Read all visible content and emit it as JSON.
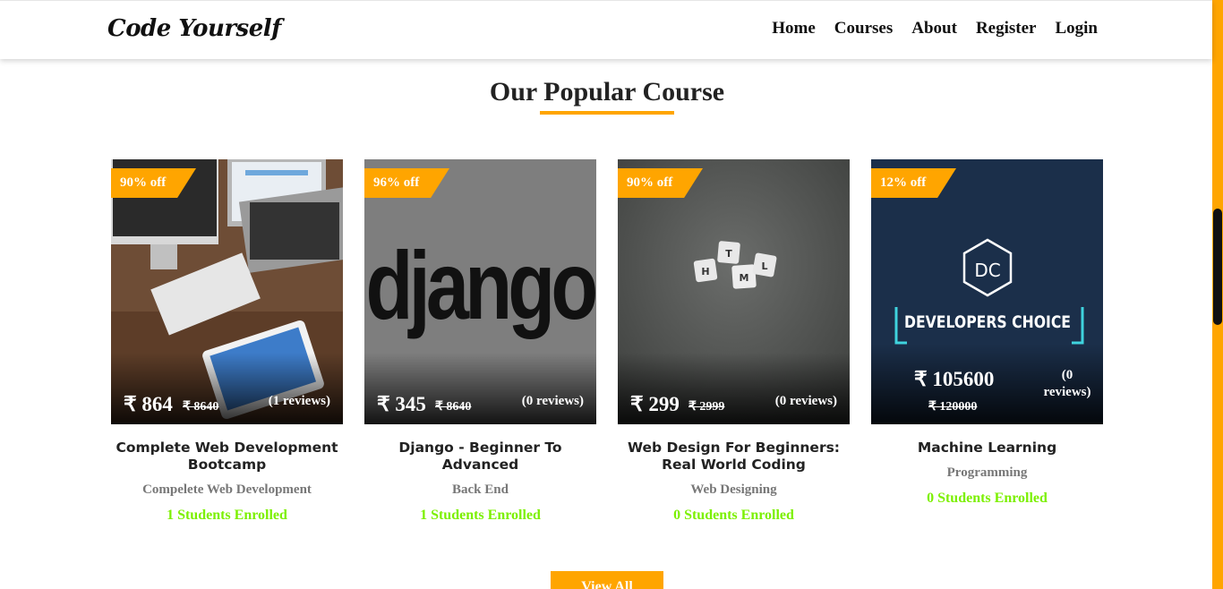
{
  "brand": "Code Yourself",
  "nav": [
    "Home",
    "Courses",
    "About",
    "Register",
    "Login"
  ],
  "section_title": "Our Popular Course",
  "cards": [
    {
      "badge": "90% off",
      "price": "₹ 864",
      "old_price": "₹ 8640",
      "reviews": "(1 reviews)",
      "title": "Complete Web Development Bootcamp",
      "category": "Compelete Web Development",
      "enrolled": "1 Students Enrolled",
      "image": "laptop-desk-photo"
    },
    {
      "badge": "96% off",
      "price": "₹ 345",
      "old_price": "₹ 8640",
      "reviews": "(0 reviews)",
      "title": "Django - Beginner To Advanced",
      "category": "Back End",
      "enrolled": "1 Students Enrolled",
      "image": "django-logo",
      "image_text": "django"
    },
    {
      "badge": "90% off",
      "price": "₹ 299",
      "old_price": "₹ 2999",
      "reviews": "(0 reviews)",
      "title": "Web Design For Beginners: Real World Coding",
      "category": "Web Designing",
      "enrolled": "0 Students Enrolled",
      "image": "html-tiles-photo",
      "image_text": [
        "H",
        "T",
        "M",
        "L"
      ]
    },
    {
      "badge": "12% off",
      "price": "₹ 105600",
      "old_price": "₹ 120000",
      "reviews": "(0 reviews)",
      "title": "Machine Learning",
      "category": "Programming",
      "enrolled": "0 Students Enrolled",
      "image": "developers-choice-logo",
      "image_text": [
        "DC",
        "DEVELOPERS CHOICE"
      ]
    }
  ],
  "view_all": "View All",
  "colors": {
    "accent": "#ffa500",
    "enrolled": "#7cf000",
    "category": "#777777"
  }
}
